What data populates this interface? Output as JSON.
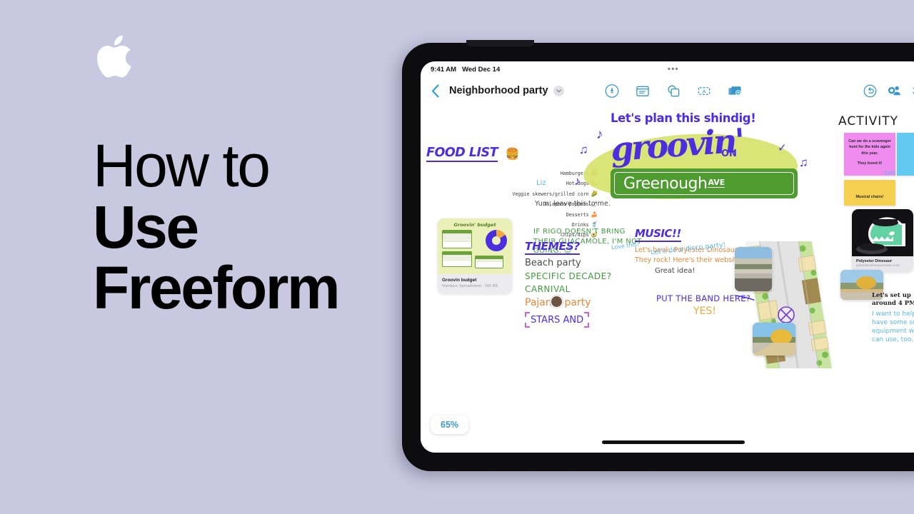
{
  "promo": {
    "logo": "apple-logo",
    "line1": "How to",
    "line2": "Use",
    "line3": "Freeform"
  },
  "device": {
    "statusbar": {
      "time": "9:41 AM",
      "date": "Wed Dec 14",
      "dots": "•••"
    },
    "toolbar": {
      "back": "‹",
      "title": "Neighborhood party",
      "title_chevron": "▾",
      "center_tools": [
        {
          "name": "pen-tool-icon",
          "label": "Markup"
        },
        {
          "name": "sticky-note-icon",
          "label": "Sticky Note"
        },
        {
          "name": "shapes-icon",
          "label": "Shapes"
        },
        {
          "name": "text-box-icon",
          "label": "Text Box"
        },
        {
          "name": "insert-media-icon",
          "label": "Insert Media"
        }
      ],
      "right_tools": [
        {
          "name": "undo-icon",
          "label": "Undo"
        },
        {
          "name": "collaborate-icon",
          "label": "Collaborate"
        }
      ],
      "collab_count": "2"
    },
    "zoom_level": "65%"
  },
  "canvas": {
    "food_list": {
      "heading": "FOOD LIST",
      "heading_emoji": "🍔",
      "items": [
        {
          "label": "Hamburgers",
          "emoji": "🍔"
        },
        {
          "label": "Hot dogs",
          "emoji": "🌭"
        },
        {
          "label": "Veggie skewers/grilled corn",
          "emoji": "🌽"
        },
        {
          "label": "Jalapeño poppers",
          "emoji": "🌶"
        },
        {
          "label": "Desserts",
          "emoji": "🍰"
        },
        {
          "label": "Drinks",
          "emoji": "🥤"
        },
        {
          "label": "Chips/dips",
          "emoji": "🥑"
        }
      ],
      "annotations": [
        {
          "text": "Liz",
          "color": "#5bb8e8"
        },
        {
          "text": "Yum, leave this to me.",
          "color": "#4a4a4a"
        },
        {
          "text": "IF RIGO DOESN'T BRING THEIR GUACAMOLE, I'M NOT GOING. ☺",
          "color": "#3f9b3f"
        }
      ]
    },
    "hero": {
      "tagline": "Let's plan this shindig!",
      "word": "groovin'",
      "on": "ON",
      "street": "Greenough",
      "street_suffix": "AVE",
      "music_notes": [
        "♪",
        "♫",
        "♪",
        "✓",
        "♫"
      ]
    },
    "music": {
      "heading": "MUSIC!!",
      "love_this": "Love this!",
      "body_line1": "Let's book, Polyester Dinosaur.",
      "body_line2": "They rock! Here's their website.",
      "great_idea": "Great idea!"
    },
    "activity": {
      "heading": "ACTIVITY",
      "stickies": [
        {
          "color": "#f08cf0",
          "text": "Can we do a scavenger hunt for the kids again this year.",
          "text2": "They loved it!"
        },
        {
          "color": "#63c8f2",
          "text": ""
        },
        {
          "color": "#f5cf50",
          "text": "Musical chairs!"
        }
      ],
      "scrawl": "This"
    },
    "dino_card": {
      "name": "Polyester Dinosaur",
      "url": "polyesterdinosaurmusic.com"
    },
    "budget_card": {
      "art_title": "Groovin' budget",
      "name": "Groovin budget",
      "subtitle": "Numbers Spreadsheet · 200 KB"
    },
    "themes": {
      "heading": "THEMES?",
      "items": [
        {
          "text": "Beach party",
          "color": "#4a4a4a"
        },
        {
          "text": "SPECIFIC DECADE?",
          "color": "#3f9b3f"
        },
        {
          "text": "CARNIVAL",
          "color": "#3f9b3f"
        },
        {
          "text": "Pajama party",
          "color": "#e8873a"
        },
        {
          "text": "STARS AND",
          "color": "#4b2ee0"
        }
      ],
      "disco_note": "Let's do a disco party!"
    },
    "band": {
      "question": "PUT THE BAND HERE?",
      "answer": "YES!"
    },
    "right_notes": {
      "setup": "Let's set up around 4 PM.",
      "equipment": "I want to help! I have some sound equipment we can use, too."
    }
  },
  "colors": {
    "background": "#c8c8e0",
    "accent_purple": "#4b2ee0",
    "accent_blue": "#3996c9",
    "accent_green": "#3f9b3f",
    "accent_orange": "#e8873a",
    "swash_green": "#d6e36a",
    "sign_green": "#4e9b2f"
  }
}
